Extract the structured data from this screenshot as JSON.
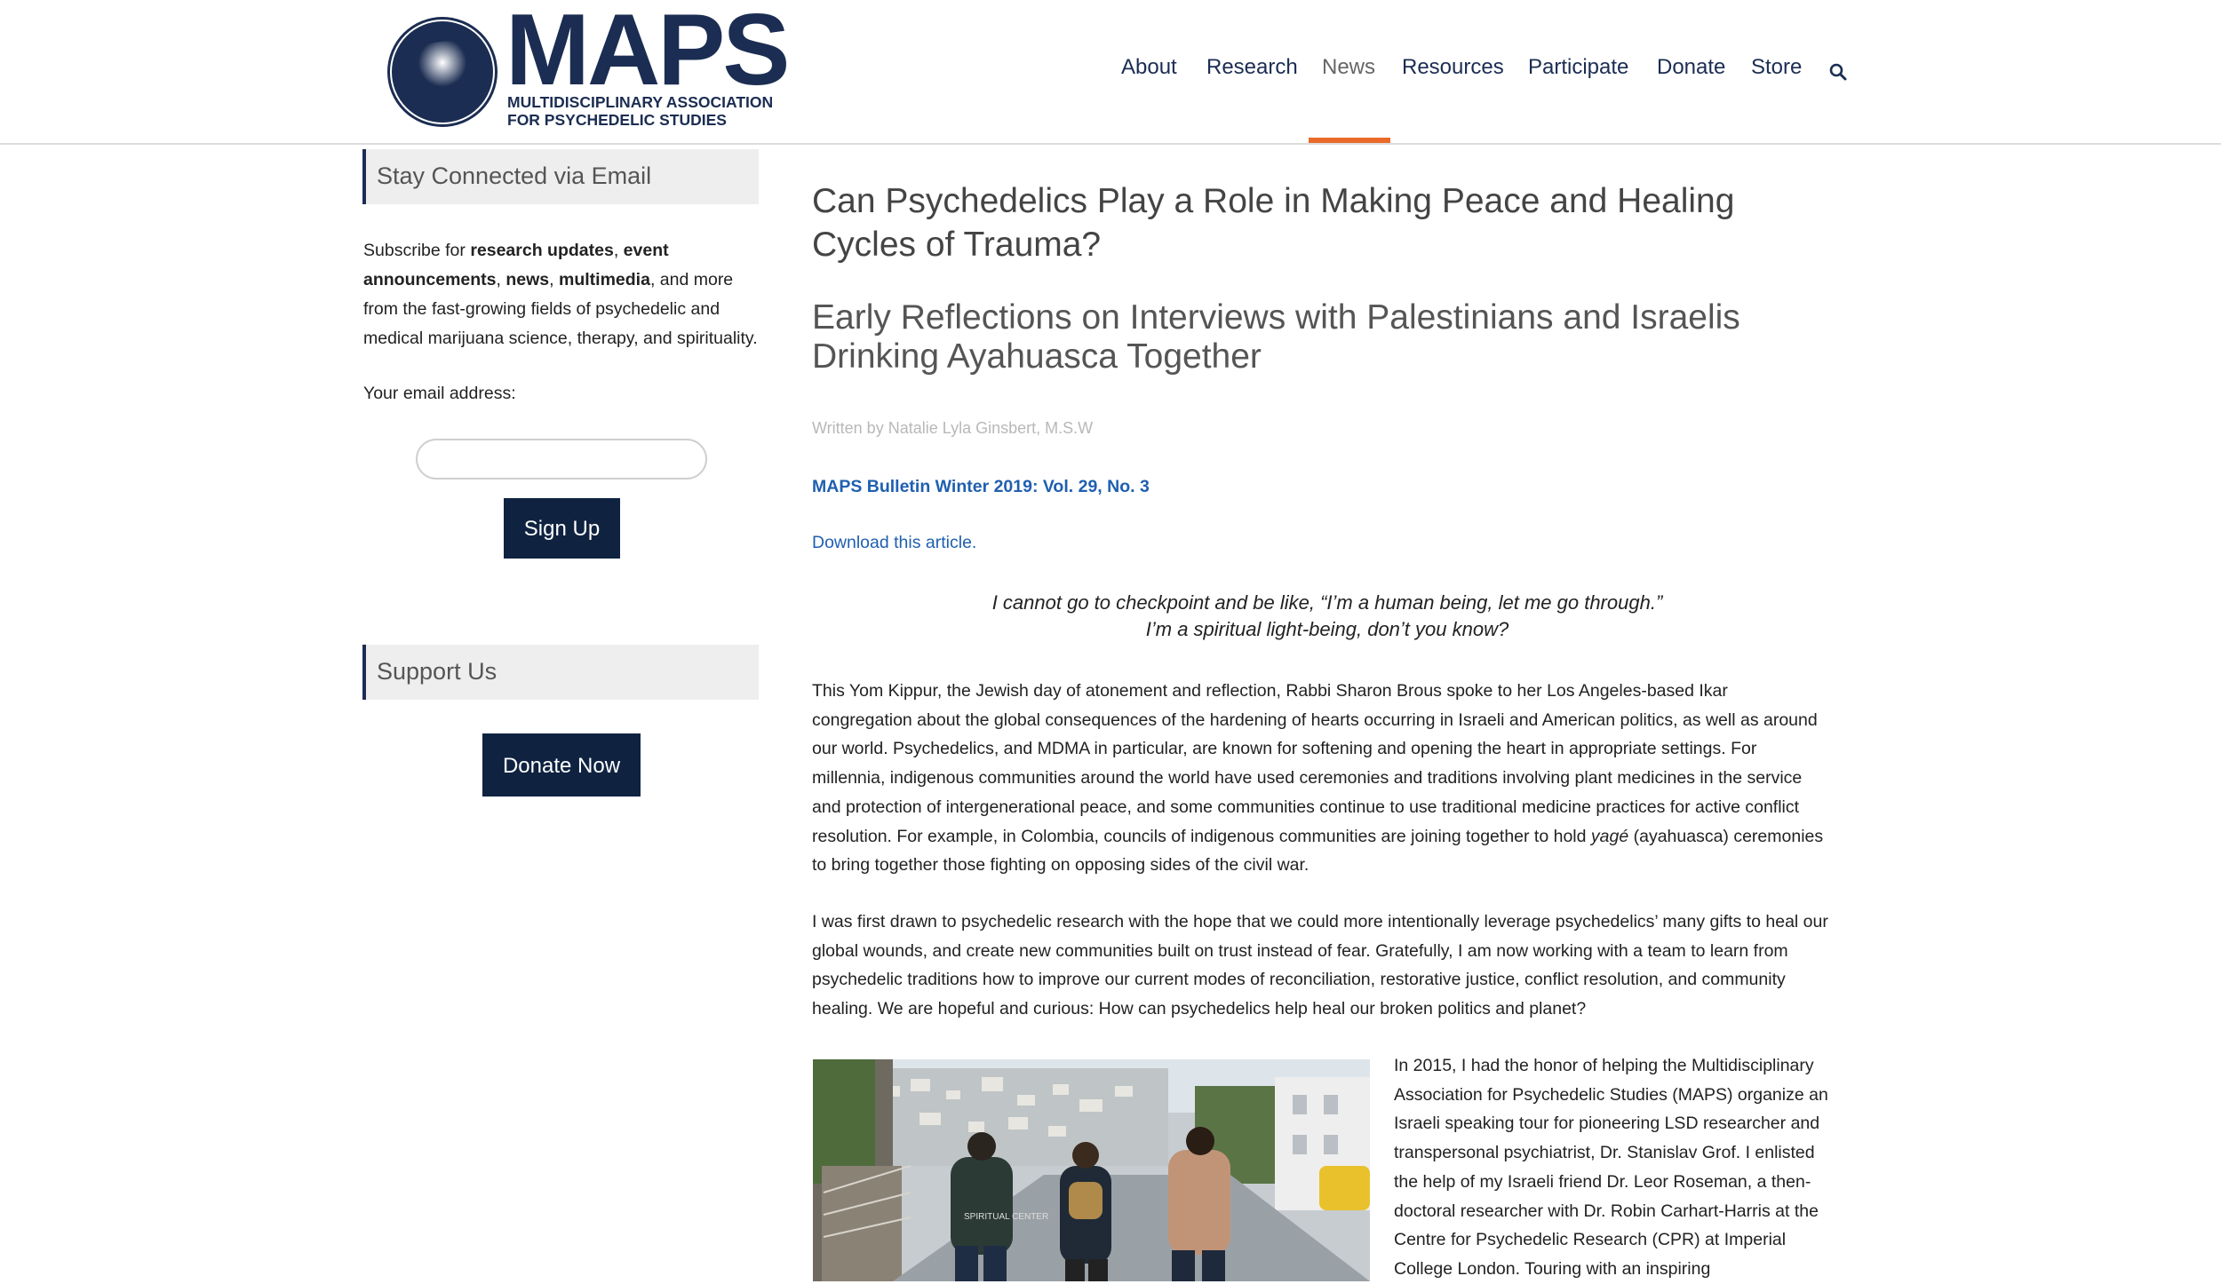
{
  "header": {
    "logo": {
      "wordmark": "MAPS",
      "subtitle_line1": "MULTIDISCIPLINARY ASSOCIATION",
      "subtitle_line2": "FOR PSYCHEDELIC STUDIES"
    },
    "nav": [
      {
        "label": "About",
        "active": false
      },
      {
        "label": "Research",
        "active": false
      },
      {
        "label": "News",
        "active": true
      },
      {
        "label": "Resources",
        "active": false
      },
      {
        "label": "Participate",
        "active": false
      },
      {
        "label": "Donate",
        "active": false
      },
      {
        "label": "Store",
        "active": false
      }
    ],
    "search_icon": "search-icon",
    "active_color": "#ea6a2a",
    "brand_color": "#1b2d52"
  },
  "sidebar": {
    "email_widget": {
      "title": "Stay Connected via Email",
      "desc_prefix": "Subscribe for ",
      "desc_b1": "research updates",
      "desc_sep1": ", ",
      "desc_b2": "event announcements",
      "desc_sep2": ", ",
      "desc_b3": "news",
      "desc_sep3": ", ",
      "desc_b4": "multimedia",
      "desc_suffix": ", and more from the fast-growing fields of psychedelic and medical marijuana science, therapy, and spirituality.",
      "email_label": "Your email address:",
      "email_value": "",
      "signup_label": "Sign Up"
    },
    "support_widget": {
      "title": "Support Us",
      "donate_label": "Donate Now"
    }
  },
  "article": {
    "title": "Can Psychedelics Play a Role in Making Peace and Healing Cycles of Trauma?",
    "subtitle": "Early Reflections on Interviews with Palestinians and Israelis Drinking Ayahuasca Together",
    "author": "Written by Natalie Lyla Ginsbert, M.S.W",
    "bulletin": "MAPS Bulletin Winter 2019: Vol. 29, No. 3",
    "download": "Download this article.",
    "quote_line1": "I cannot go to checkpoint and be like, “I’m a human being, let me go through.”",
    "quote_line2": "I’m a spiritual light-being, don’t you know?",
    "p1_a": "This Yom Kippur, the Jewish day of atonement and reflection, Rabbi Sharon Brous spoke to her Los Angeles-based Ikar congregation about the global consequences of the hardening of hearts occurring in Israeli and American politics, as well as around our world. Psychedelics, and MDMA in particular, are known for softening and opening the heart in appropriate settings. For millennia, indigenous communities around the world have used ceremonies and traditions involving plant medicines in the service and protection of intergenerational peace, and some communities continue to use traditional medicine practices for active conflict resolution. For example, in Colombia, councils of indigenous communities are joining together to hold ",
    "p1_em": "yagé",
    "p1_b": " (ayahuasca) ceremonies to bring together those fighting on opposing sides of the civil war.",
    "p2": "I was first drawn to psychedelic research with the hope that we could more intentionally leverage psychedelics’ many gifts to heal our global wounds, and create new communities built on trust instead of fear. Gratefully, I am now working with a team to learn from psychedelic traditions how to improve our current modes of reconciliation, restorative justice, conflict resolution, and community healing. We are hopeful and curious: How can psychedelics help heal our broken politics and planet?",
    "p3": "In 2015, I had the honor of helping the Multidisciplinary Association for Psychedelic Studies (MAPS) organize an Israeli speaking tour for pioneering LSD researcher and transpersonal psychiatrist, Dr. Stanislav Grof. I enlisted the help of my Israeli friend Dr. Leor Roseman, a then-doctoral researcher with Dr. Robin Carhart-Harris at the Centre for Psychedelic Research (CPR) at Imperial College London. Touring with an inspiring",
    "photo_hoodie_text": "SPIRITUAL CENTER"
  }
}
